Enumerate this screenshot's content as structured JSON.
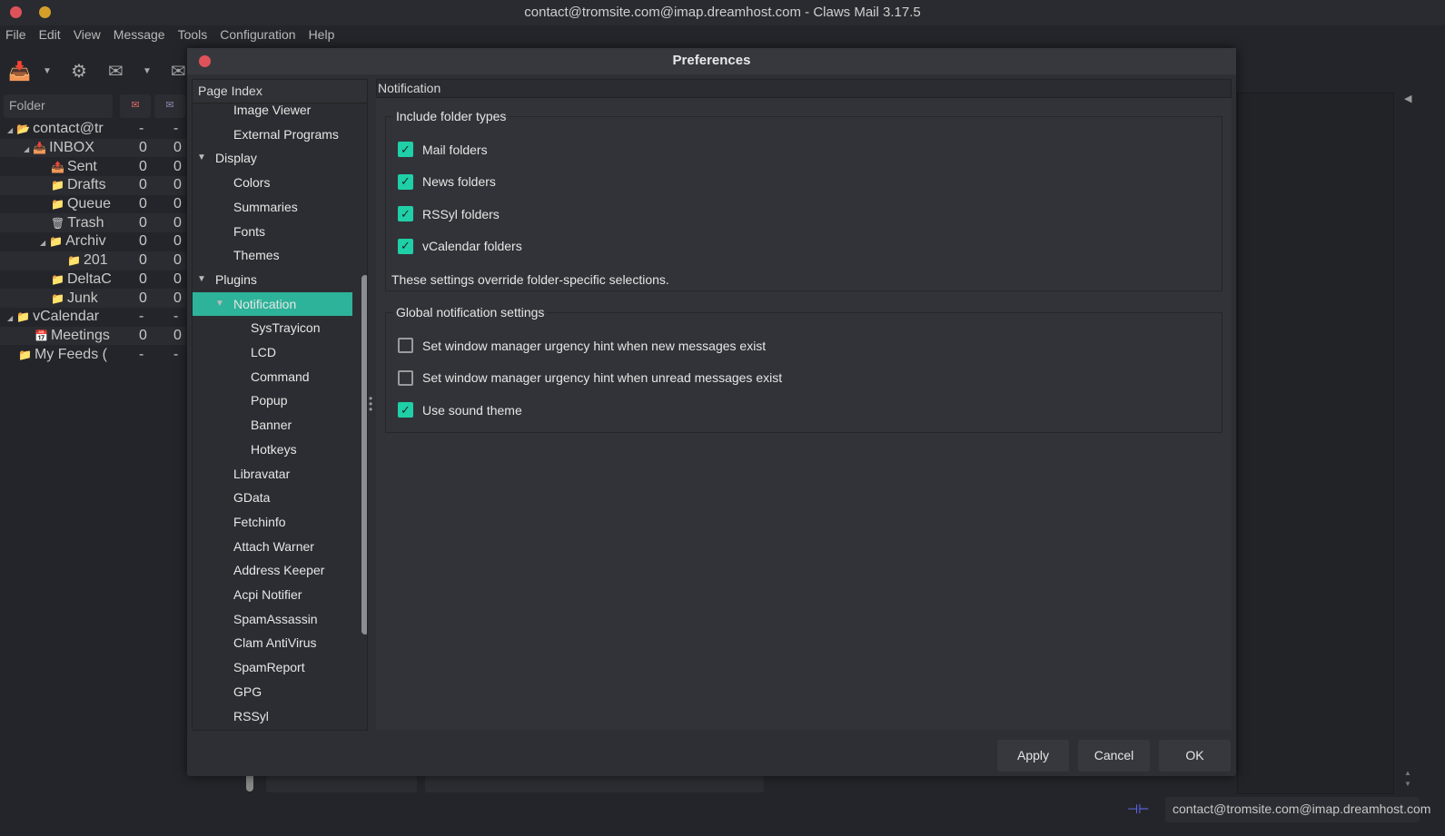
{
  "window": {
    "title": "contact@tromsite.com@imap.dreamhost.com - Claws Mail 3.17.5"
  },
  "menu": [
    "File",
    "Edit",
    "View",
    "Message",
    "Tools",
    "Configuration",
    "Help"
  ],
  "folder_pane": {
    "header": "Folder",
    "rows": [
      {
        "name": "contact@tr",
        "unread": "-",
        "total": "-",
        "indent": 0,
        "expander": "◢",
        "icon": "📂"
      },
      {
        "name": "INBOX",
        "unread": "0",
        "total": "0",
        "indent": 1,
        "expander": "◢",
        "icon": "📥"
      },
      {
        "name": "Sent",
        "unread": "0",
        "total": "0",
        "indent": 2,
        "icon": "📤"
      },
      {
        "name": "Drafts",
        "unread": "0",
        "total": "0",
        "indent": 2,
        "icon": "📁"
      },
      {
        "name": "Queue",
        "unread": "0",
        "total": "0",
        "indent": 2,
        "icon": "📁"
      },
      {
        "name": "Trash",
        "unread": "0",
        "total": "0",
        "indent": 2,
        "icon": "🗑"
      },
      {
        "name": "Archiv",
        "unread": "0",
        "total": "0",
        "indent": 2,
        "expander": "◢",
        "icon": "📁"
      },
      {
        "name": "201",
        "unread": "0",
        "total": "0",
        "indent": 3,
        "icon": "📁"
      },
      {
        "name": "DeltaC",
        "unread": "0",
        "total": "0",
        "indent": 2,
        "icon": "📁"
      },
      {
        "name": "Junk",
        "unread": "0",
        "total": "0",
        "indent": 2,
        "icon": "📁"
      },
      {
        "name": "vCalendar",
        "unread": "-",
        "total": "-",
        "indent": 0,
        "expander": "◢",
        "icon": "📁"
      },
      {
        "name": "Meetings",
        "unread": "0",
        "total": "0",
        "indent": 1,
        "icon": "📅"
      },
      {
        "name": "My Feeds (",
        "unread": "-",
        "total": "-",
        "indent": 0,
        "icon": "📁"
      }
    ]
  },
  "dialog": {
    "title": "Preferences",
    "page_index": {
      "header": "Page Index",
      "items": [
        {
          "label": "Image Viewer",
          "level": 1
        },
        {
          "label": "External Programs",
          "level": 1
        },
        {
          "label": "Display",
          "level": 0,
          "expanded": true
        },
        {
          "label": "Colors",
          "level": 1
        },
        {
          "label": "Summaries",
          "level": 1
        },
        {
          "label": "Fonts",
          "level": 1
        },
        {
          "label": "Themes",
          "level": 1
        },
        {
          "label": "Plugins",
          "level": 0,
          "expanded": true
        },
        {
          "label": "Notification",
          "level": 1,
          "expanded": true,
          "selected": true
        },
        {
          "label": "SysTrayicon",
          "level": 2
        },
        {
          "label": "LCD",
          "level": 2
        },
        {
          "label": "Command",
          "level": 2
        },
        {
          "label": "Popup",
          "level": 2
        },
        {
          "label": "Banner",
          "level": 2
        },
        {
          "label": "Hotkeys",
          "level": 2
        },
        {
          "label": "Libravatar",
          "level": 1
        },
        {
          "label": "GData",
          "level": 1
        },
        {
          "label": "Fetchinfo",
          "level": 1
        },
        {
          "label": "Attach Warner",
          "level": 1
        },
        {
          "label": "Address Keeper",
          "level": 1
        },
        {
          "label": "Acpi Notifier",
          "level": 1
        },
        {
          "label": "SpamAssassin",
          "level": 1
        },
        {
          "label": "Clam AntiVirus",
          "level": 1
        },
        {
          "label": "SpamReport",
          "level": 1
        },
        {
          "label": "GPG",
          "level": 1
        },
        {
          "label": "RSSyl",
          "level": 1
        }
      ]
    },
    "page_title": "Notification",
    "folder_types": {
      "legend": "Include folder types",
      "options": [
        {
          "label": "Mail folders",
          "checked": true
        },
        {
          "label": "News folders",
          "checked": true
        },
        {
          "label": "RSSyl folders",
          "checked": true
        },
        {
          "label": "vCalendar folders",
          "checked": true
        }
      ],
      "note": "These settings override folder-specific selections."
    },
    "global": {
      "legend": "Global notification settings",
      "options": [
        {
          "label": "Set window manager urgency hint when new messages exist",
          "checked": false
        },
        {
          "label": "Set window manager urgency hint when unread messages exist",
          "checked": false
        },
        {
          "label": "Use sound theme",
          "checked": true
        }
      ]
    },
    "buttons": {
      "apply": "Apply",
      "cancel": "Cancel",
      "ok": "OK"
    }
  },
  "statusbar": {
    "account": "contact@tromsite.com@imap.dreamhost.com"
  },
  "colors": {
    "accent": "#2db39a",
    "checkbox": "#1fcfa8",
    "close": "#e0525a",
    "minimize": "#d4a02a"
  }
}
